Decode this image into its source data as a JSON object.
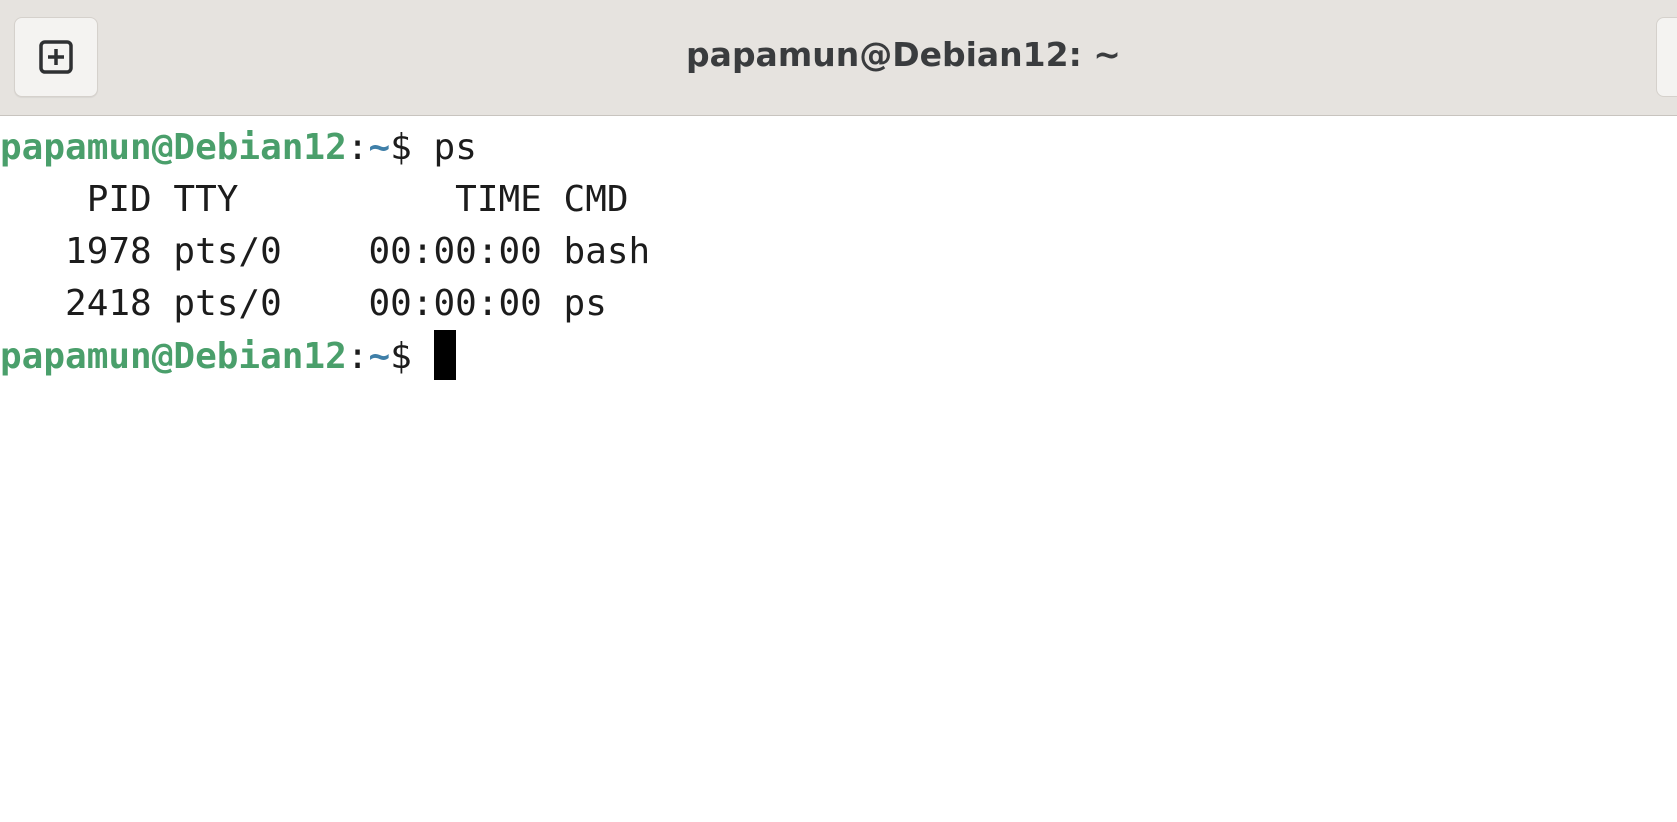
{
  "window": {
    "title": "papamun@Debian12: ~"
  },
  "toolbar": {
    "new_tab_icon": "plus-square-icon"
  },
  "terminal": {
    "prompt_user": "papamun@Debian12",
    "prompt_colon": ":",
    "prompt_path": "~",
    "prompt_sign": "$ ",
    "command": "ps",
    "output_header": "    PID TTY          TIME CMD",
    "output_rows": [
      "   1978 pts/0    00:00:00 bash",
      "   2418 pts/0    00:00:00 ps"
    ]
  },
  "colors": {
    "prompt_user": "#4a9f6b",
    "prompt_path": "#3f7fa8",
    "titlebar_bg": "#e6e3df",
    "terminal_bg": "#ffffff",
    "text": "#1c1c1c"
  }
}
